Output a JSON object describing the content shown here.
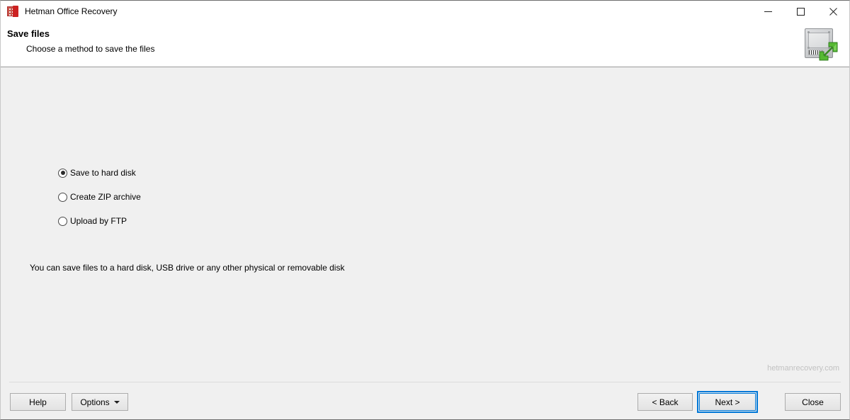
{
  "window": {
    "title": "Hetman Office Recovery",
    "app_icon": "office-document-icon",
    "controls": {
      "minimize": "minimize-icon",
      "maximize": "maximize-icon",
      "close": "close-icon"
    }
  },
  "header": {
    "title": "Save files",
    "subtitle": "Choose a method to save the files",
    "graphic": "hard-disk-save-icon"
  },
  "main": {
    "options": [
      {
        "label": "Save to hard disk",
        "selected": true
      },
      {
        "label": "Create ZIP archive",
        "selected": false
      },
      {
        "label": "Upload by FTP",
        "selected": false
      }
    ],
    "description": "You can save files to a hard disk, USB drive or any other physical or removable disk",
    "watermark": "hetmanrecovery.com"
  },
  "footer": {
    "help_label": "Help",
    "options_label": "Options",
    "back_label": "< Back",
    "next_label": "Next >",
    "close_label": "Close"
  },
  "colors": {
    "accent": "#0078d7",
    "content_bg": "#f0f0f0",
    "titlebar_bg": "#ffffff",
    "watermark": "#c2c2c2",
    "app_icon_red": "#cc2222",
    "arrow_green": "#56b933"
  }
}
